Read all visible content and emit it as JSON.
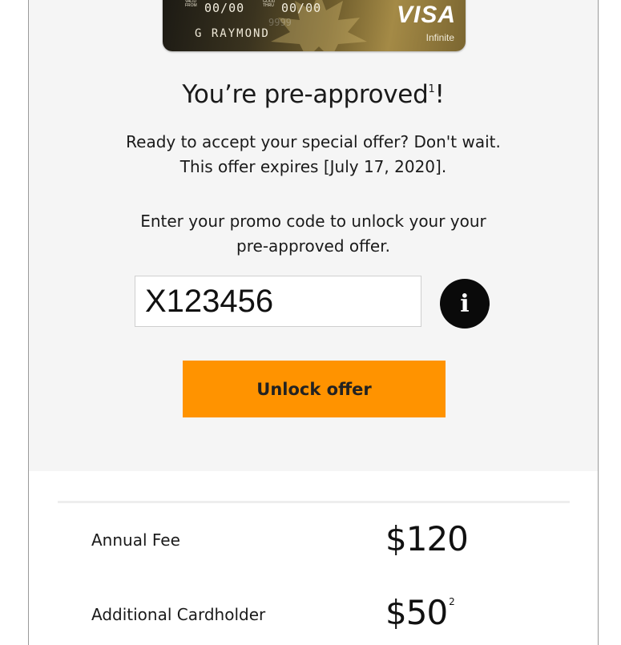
{
  "card": {
    "valid_from_label": "VALID FROM",
    "valid_from": "00/00",
    "good_thru_label": "GOOD THRU",
    "good_thru": "00/00",
    "ghost_digits": "9999",
    "holder_name": "G RAYMOND",
    "network": "VISA",
    "tier": "Infinite"
  },
  "offer": {
    "title": "You’re pre-approved",
    "title_footnote": "1",
    "title_suffix": "!",
    "line1": "Ready to accept your special offer? Don't wait.",
    "line2": "This offer expires [July 17, 2020].",
    "promo_line1": "Enter your promo code to unlock your your",
    "promo_line2": "pre-approved offer."
  },
  "promo": {
    "value": "X123456",
    "info_icon": "i"
  },
  "actions": {
    "unlock_label": "Unlock offer"
  },
  "fees": [
    {
      "label": "Annual Fee",
      "value": "$120",
      "footnote": ""
    },
    {
      "label": "Additional Cardholder",
      "value": "$50",
      "footnote": "2"
    }
  ],
  "colors": {
    "accent": "#ff9300",
    "hero_bg": "#f5f5f5",
    "info_bg": "#0a0a0a"
  }
}
